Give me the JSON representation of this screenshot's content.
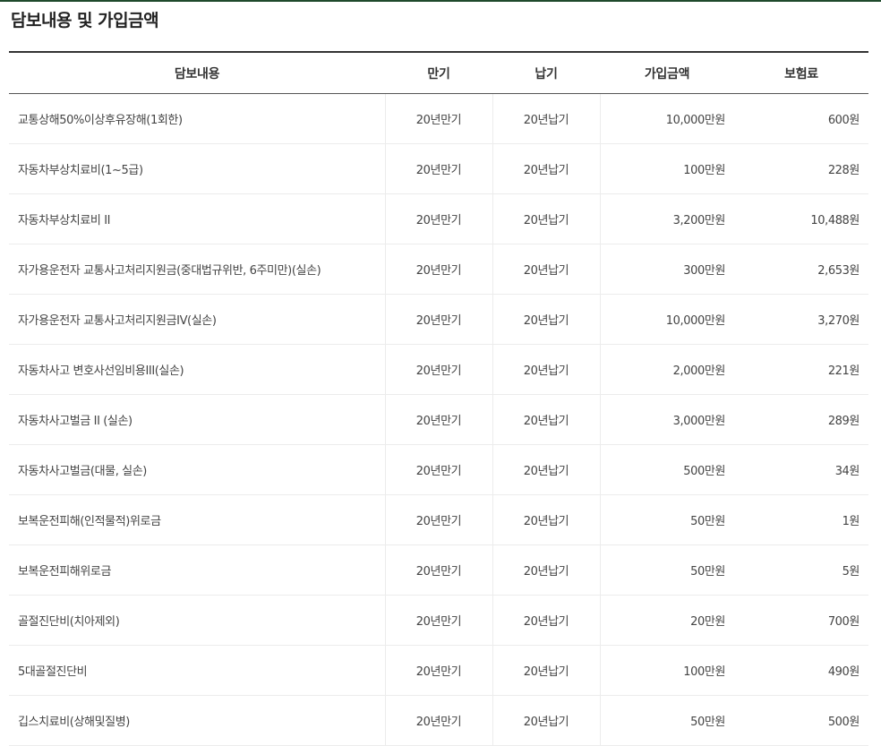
{
  "section": {
    "title": "담보내용 및 가입금액"
  },
  "table": {
    "headers": [
      "담보내용",
      "만기",
      "납기",
      "가입금액",
      "보험료"
    ],
    "rows": [
      [
        "교통상해50%이상후유장해(1회한)",
        "20년만기",
        "20년납기",
        "10,000만원",
        "600원"
      ],
      [
        "자동차부상치료비(1~5급)",
        "20년만기",
        "20년납기",
        "100만원",
        "228원"
      ],
      [
        "자동차부상치료비 II",
        "20년만기",
        "20년납기",
        "3,200만원",
        "10,488원"
      ],
      [
        "자가용운전자 교통사고처리지원금(중대법규위반, 6주미만)(실손)",
        "20년만기",
        "20년납기",
        "300만원",
        "2,653원"
      ],
      [
        "자가용운전자 교통사고처리지원금IV(실손)",
        "20년만기",
        "20년납기",
        "10,000만원",
        "3,270원"
      ],
      [
        "자동차사고 변호사선임비용III(실손)",
        "20년만기",
        "20년납기",
        "2,000만원",
        "221원"
      ],
      [
        "자동차사고벌금 II (실손)",
        "20년만기",
        "20년납기",
        "3,000만원",
        "289원"
      ],
      [
        "자동차사고벌금(대물, 실손)",
        "20년만기",
        "20년납기",
        "500만원",
        "34원"
      ],
      [
        "보복운전피해(인적물적)위로금",
        "20년만기",
        "20년납기",
        "50만원",
        "1원"
      ],
      [
        "보복운전피해위로금",
        "20년만기",
        "20년납기",
        "50만원",
        "5원"
      ],
      [
        "골절진단비(치아제외)",
        "20년만기",
        "20년납기",
        "20만원",
        "700원"
      ],
      [
        "5대골절진단비",
        "20년만기",
        "20년납기",
        "100만원",
        "490원"
      ],
      [
        "깁스치료비(상해및질병)",
        "20년만기",
        "20년납기",
        "50만원",
        "500원"
      ]
    ]
  },
  "colors": {
    "top_line": "#1f4a2c",
    "header_border": "#333333",
    "row_border": "#ececec"
  }
}
